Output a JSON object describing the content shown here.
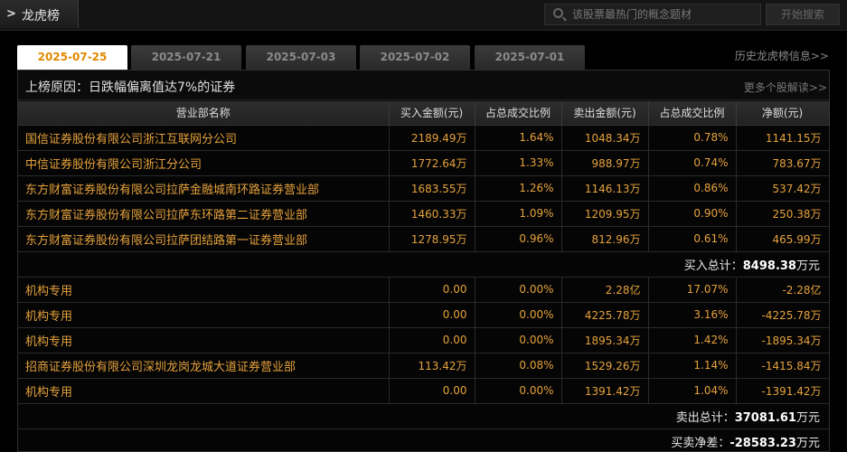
{
  "header": {
    "title": "龙虎榜",
    "search_placeholder": "该股票最热门的概念题材",
    "search_button": "开始搜索"
  },
  "tabs": [
    {
      "label": "2025-07-25",
      "active": true
    },
    {
      "label": "2025-07-21",
      "active": false
    },
    {
      "label": "2025-07-03",
      "active": false
    },
    {
      "label": "2025-07-02",
      "active": false
    },
    {
      "label": "2025-07-01",
      "active": false
    }
  ],
  "history_link": "历史龙虎榜信息>>",
  "reason": {
    "label": "上榜原因：",
    "value": "日跌幅偏离值达7%的证券",
    "more_link": "更多个股解读>>"
  },
  "table": {
    "columns": [
      "营业部名称",
      "买入金额(元)",
      "占总成交比例",
      "卖出金额(元)",
      "占总成交比例",
      "净额(元)"
    ],
    "buy_rows": [
      [
        "国信证券股份有限公司浙江互联网分公司",
        "2189.49万",
        "1.64%",
        "1048.34万",
        "0.78%",
        "1141.15万"
      ],
      [
        "中信证券股份有限公司浙江分公司",
        "1772.64万",
        "1.33%",
        "988.97万",
        "0.74%",
        "783.67万"
      ],
      [
        "东方财富证券股份有限公司拉萨金融城南环路证券营业部",
        "1683.55万",
        "1.26%",
        "1146.13万",
        "0.86%",
        "537.42万"
      ],
      [
        "东方财富证券股份有限公司拉萨东环路第二证券营业部",
        "1460.33万",
        "1.09%",
        "1209.95万",
        "0.90%",
        "250.38万"
      ],
      [
        "东方财富证券股份有限公司拉萨团结路第一证券营业部",
        "1278.95万",
        "0.96%",
        "812.96万",
        "0.61%",
        "465.99万"
      ]
    ],
    "buy_total_label": "买入总计：",
    "buy_total_value": "8498.38",
    "buy_total_unit": "万元",
    "sell_rows": [
      [
        "机构专用",
        "0.00",
        "0.00%",
        "2.28亿",
        "17.07%",
        "-2.28亿"
      ],
      [
        "机构专用",
        "0.00",
        "0.00%",
        "4225.78万",
        "3.16%",
        "-4225.78万"
      ],
      [
        "机构专用",
        "0.00",
        "0.00%",
        "1895.34万",
        "1.42%",
        "-1895.34万"
      ],
      [
        "招商证券股份有限公司深圳龙岗龙城大道证券营业部",
        "113.42万",
        "0.08%",
        "1529.26万",
        "1.14%",
        "-1415.84万"
      ],
      [
        "机构专用",
        "0.00",
        "0.00%",
        "1391.42万",
        "1.04%",
        "-1391.42万"
      ]
    ],
    "sell_total_label": "卖出总计：",
    "sell_total_value": "37081.61",
    "sell_total_unit": "万元",
    "net_label": "买卖净差：",
    "net_value": "-28583.23",
    "net_unit": "万元"
  }
}
